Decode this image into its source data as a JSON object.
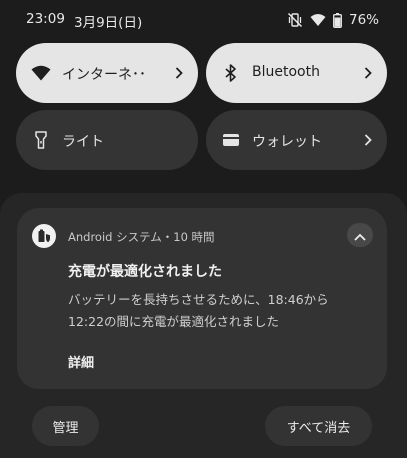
{
  "status_bar": {
    "time": "23:09",
    "date": "3月9日(日)",
    "battery": "76%",
    "icons": [
      "mute-vibrate-icon",
      "wifi-icon",
      "battery-icon"
    ]
  },
  "quick_settings": {
    "tiles": [
      {
        "label": "インターネ･･",
        "icon": "wifi-icon",
        "state": "on",
        "has_chevron": true
      },
      {
        "label": "Bluetooth",
        "icon": "bluetooth-icon",
        "state": "on",
        "has_chevron": true
      },
      {
        "label": "ライト",
        "icon": "flashlight-icon",
        "state": "off",
        "has_chevron": false
      },
      {
        "label": "ウォレット",
        "icon": "wallet-icon",
        "state": "off",
        "has_chevron": true
      }
    ]
  },
  "notification": {
    "header": "Android システム・10 時間",
    "title": "充電が最適化されました",
    "body_line1": "バッテリーを長持ちさせるために、18:46から",
    "body_line2": "12:22の間に充電が最適化されました",
    "action": "詳細",
    "app_icon": "battery-shield-icon"
  },
  "footer": {
    "manage_label": "管理",
    "clear_all_label": "すべて消去"
  },
  "colors": {
    "background": "#1c1c1c",
    "tile_on": "#e5e5e5",
    "tile_off": "#343434",
    "panel": "#262626",
    "card": "#333333"
  }
}
